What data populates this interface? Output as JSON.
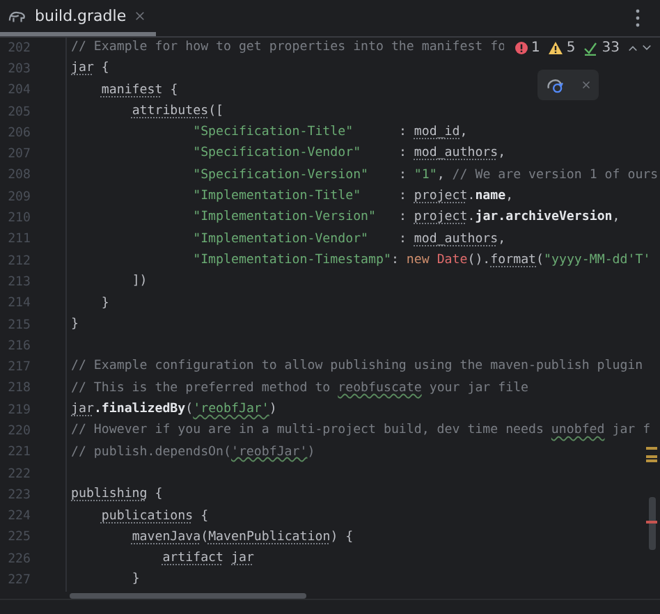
{
  "tab": {
    "label": "build.gradle",
    "selected": true
  },
  "inspections": {
    "errors": "1",
    "warnings": "5",
    "passed": "33"
  },
  "lines": [
    {
      "number": "202",
      "tokens": [
        {
          "kind": "comment",
          "text": "// Example for how to get properties into the manifest fo"
        }
      ]
    },
    {
      "number": "203",
      "tokens": [
        {
          "kind": "dynamic",
          "text": "jar"
        },
        {
          "kind": "plain",
          "text": " {"
        }
      ]
    },
    {
      "number": "204",
      "tokens": [
        {
          "kind": "dynamic",
          "text": "    manifest"
        },
        {
          "kind": "plain",
          "text": " {"
        }
      ]
    },
    {
      "number": "205",
      "tokens": [
        {
          "kind": "dynamic",
          "text": "        attributes"
        },
        {
          "kind": "plain",
          "text": "(["
        }
      ]
    },
    {
      "number": "206",
      "tokens": [
        {
          "kind": "string",
          "text": "                \"Specification-Title\""
        },
        {
          "kind": "plain",
          "text": "      : "
        },
        {
          "kind": "dynamic",
          "text": "mod_id"
        },
        {
          "kind": "plain",
          "text": ","
        }
      ]
    },
    {
      "number": "207",
      "tokens": [
        {
          "kind": "string",
          "text": "                \"Specification-Vendor\""
        },
        {
          "kind": "plain",
          "text": "     : "
        },
        {
          "kind": "dynamic",
          "text": "mod_authors"
        },
        {
          "kind": "plain",
          "text": ","
        }
      ]
    },
    {
      "number": "208",
      "tokens": [
        {
          "kind": "string",
          "text": "                \"Specification-Version\""
        },
        {
          "kind": "plain",
          "text": "    : "
        },
        {
          "kind": "string",
          "text": "\"1\""
        },
        {
          "kind": "plain",
          "text": ", "
        },
        {
          "kind": "comment",
          "text": "// We are version 1 of ours"
        }
      ]
    },
    {
      "number": "209",
      "tokens": [
        {
          "kind": "string",
          "text": "                \"Implementation-Title\""
        },
        {
          "kind": "plain",
          "text": "     : "
        },
        {
          "kind": "dynamic",
          "text": "project"
        },
        {
          "kind": "plain",
          "text": "."
        },
        {
          "kind": "field",
          "text": "name"
        },
        {
          "kind": "plain",
          "text": ","
        }
      ]
    },
    {
      "number": "210",
      "tokens": [
        {
          "kind": "string",
          "text": "                \"Implementation-Version\""
        },
        {
          "kind": "plain",
          "text": "   : "
        },
        {
          "kind": "dynamic",
          "text": "project"
        },
        {
          "kind": "plain",
          "text": "."
        },
        {
          "kind": "field",
          "text": "jar.archiveVersion"
        },
        {
          "kind": "plain",
          "text": ","
        }
      ]
    },
    {
      "number": "211",
      "tokens": [
        {
          "kind": "string",
          "text": "                \"Implementation-Vendor\""
        },
        {
          "kind": "plain",
          "text": "    : "
        },
        {
          "kind": "dynamic",
          "text": "mod_authors"
        },
        {
          "kind": "plain",
          "text": ","
        }
      ]
    },
    {
      "number": "212",
      "tokens": [
        {
          "kind": "string",
          "text": "                \"Implementation-Timestamp\""
        },
        {
          "kind": "plain",
          "text": ": "
        },
        {
          "kind": "keyword",
          "text": "new "
        },
        {
          "kind": "type",
          "text": "Date"
        },
        {
          "kind": "plain",
          "text": "()."
        },
        {
          "kind": "dynamic",
          "text": "format"
        },
        {
          "kind": "plain",
          "text": "("
        },
        {
          "kind": "string",
          "text": "\"yyyy-MM-dd'T'"
        }
      ]
    },
    {
      "number": "213",
      "tokens": [
        {
          "kind": "plain",
          "text": "        ])"
        }
      ]
    },
    {
      "number": "214",
      "tokens": [
        {
          "kind": "plain",
          "text": "    }"
        }
      ]
    },
    {
      "number": "215",
      "tokens": [
        {
          "kind": "plain",
          "text": "}"
        }
      ]
    },
    {
      "number": "216"
    },
    {
      "number": "217",
      "tokens": [
        {
          "kind": "comment",
          "text": "// Example configuration to allow publishing using the maven-publish plugin"
        }
      ]
    },
    {
      "number": "218",
      "tokens": [
        {
          "kind": "comment",
          "text": "// This is the preferred method to "
        },
        {
          "kind": "comment-typo",
          "text": "reobfuscate"
        },
        {
          "kind": "comment",
          "text": " your jar file"
        }
      ]
    },
    {
      "number": "219",
      "tokens": [
        {
          "kind": "dynamic",
          "text": "jar"
        },
        {
          "kind": "field",
          "text": ".finalizedBy"
        },
        {
          "kind": "plain",
          "text": "("
        },
        {
          "kind": "string-typo",
          "text": "'reobfJar'"
        },
        {
          "kind": "plain",
          "text": ")"
        }
      ]
    },
    {
      "number": "220",
      "tokens": [
        {
          "kind": "comment",
          "text": "// However if you are in a multi-project build, dev time needs "
        },
        {
          "kind": "comment-typo",
          "text": "unobfed"
        },
        {
          "kind": "comment",
          "text": " jar f"
        }
      ]
    },
    {
      "number": "221",
      "tokens": [
        {
          "kind": "comment",
          "text": "// publish.dependsOn("
        },
        {
          "kind": "comment-typo",
          "text": "'reobfJar'"
        },
        {
          "kind": "comment",
          "text": ")"
        }
      ]
    },
    {
      "number": "222"
    },
    {
      "number": "223",
      "tokens": [
        {
          "kind": "dynamic",
          "text": "publishing"
        },
        {
          "kind": "plain",
          "text": " {"
        }
      ]
    },
    {
      "number": "224",
      "tokens": [
        {
          "kind": "dynamic",
          "text": "    publications"
        },
        {
          "kind": "plain",
          "text": " {"
        }
      ]
    },
    {
      "number": "225",
      "tokens": [
        {
          "kind": "dynamic",
          "text": "        mavenJava"
        },
        {
          "kind": "plain",
          "text": "("
        },
        {
          "kind": "dynamic",
          "text": "MavenPublication"
        },
        {
          "kind": "plain",
          "text": ") {"
        }
      ]
    },
    {
      "number": "226",
      "tokens": [
        {
          "kind": "dynamic",
          "text": "            artifact"
        },
        {
          "kind": "dynamic",
          "text": " jar"
        }
      ]
    },
    {
      "number": "227",
      "tokens": [
        {
          "kind": "plain",
          "text": "        }"
        }
      ]
    }
  ]
}
